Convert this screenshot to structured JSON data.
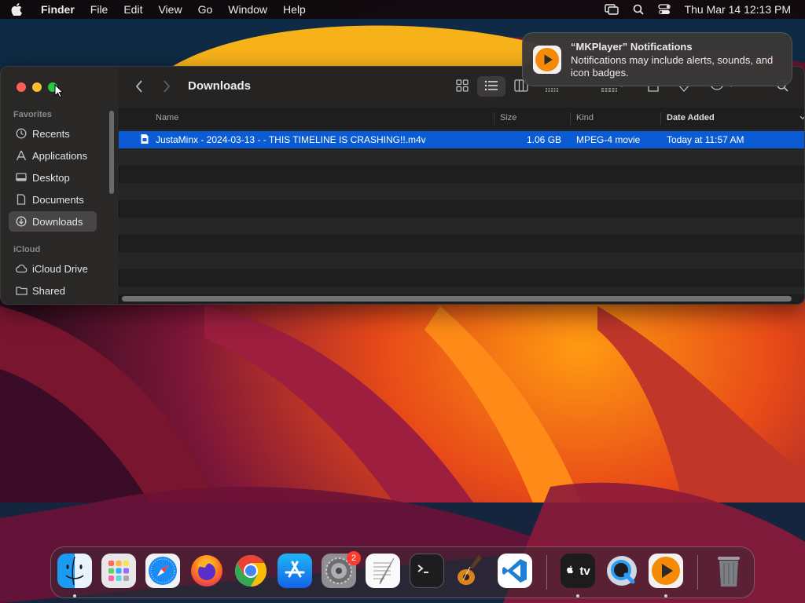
{
  "menubar": {
    "app_name": "Finder",
    "items": [
      "File",
      "Edit",
      "View",
      "Go",
      "Window",
      "Help"
    ],
    "clock": "Thu Mar 14  12:13 PM"
  },
  "notification": {
    "title": "“MKPlayer” Notifications",
    "body": "Notifications may include alerts, sounds, and icon badges."
  },
  "finder": {
    "title": "Downloads",
    "sidebar": {
      "favorites_header": "Favorites",
      "favorites": [
        "Recents",
        "Applications",
        "Desktop",
        "Documents",
        "Downloads"
      ],
      "icloud_header": "iCloud",
      "icloud": [
        "iCloud Drive",
        "Shared"
      ]
    },
    "columns": {
      "name": "Name",
      "size": "Size",
      "kind": "Kind",
      "date_added": "Date Added"
    },
    "files": [
      {
        "name": "JustaMinx  - 2024-03-13 - - THIS TIMELINE IS CRASHING!!.m4v",
        "size": "1.06 GB",
        "kind": "MPEG-4 movie",
        "date_added": "Today at 11:57 AM"
      }
    ]
  },
  "dock": {
    "settings_badge": "2",
    "apps": [
      "finder-icon",
      "launchpad-icon",
      "safari-icon",
      "firefox-icon",
      "chrome-icon",
      "app-store-icon",
      "system-settings-icon",
      "textedit-icon",
      "terminal-icon",
      "garageband-icon",
      "vscode-icon",
      "apple-tv-icon",
      "quicktime-icon",
      "mkplayer-icon",
      "trash-icon"
    ],
    "apple_tv_label": "tv"
  },
  "colors": {
    "selection": "#0a5bd4",
    "close": "#fe5f57",
    "minimize": "#febc2e",
    "maximize": "#28c840",
    "badge": "#ff3b30"
  }
}
